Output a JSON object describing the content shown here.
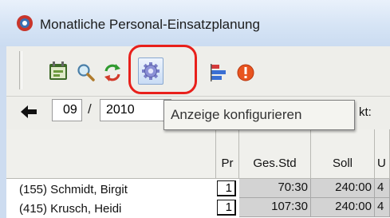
{
  "window": {
    "title": "Monatliche Personal-Einsatzplanung"
  },
  "toolbar": {
    "buttons": [
      {
        "icon": "calendar-icon"
      },
      {
        "icon": "search-icon"
      },
      {
        "icon": "refresh-icon"
      },
      {
        "icon": "gear-icon",
        "highlighted": true
      },
      {
        "icon": "bar-chart-icon"
      },
      {
        "icon": "alert-icon"
      }
    ],
    "highlight_color": "#e8201b"
  },
  "navigation": {
    "month": "09",
    "separator": "/",
    "year": "2010",
    "label_fragment": "kt:"
  },
  "tooltip": {
    "text": "Anzeige konfigurieren"
  },
  "grid": {
    "columns": [
      "Pr",
      "Ges.Std",
      "Soll",
      "U"
    ],
    "rows": [
      {
        "name": "(155) Schmidt, Birgit",
        "pr": "1",
        "ges_std": "70:30",
        "soll": "240:00",
        "u": "4"
      },
      {
        "name": "(415) Krusch, Heidi",
        "pr": "1",
        "ges_std": "107:30",
        "soll": "240:00",
        "u": "4"
      }
    ]
  }
}
